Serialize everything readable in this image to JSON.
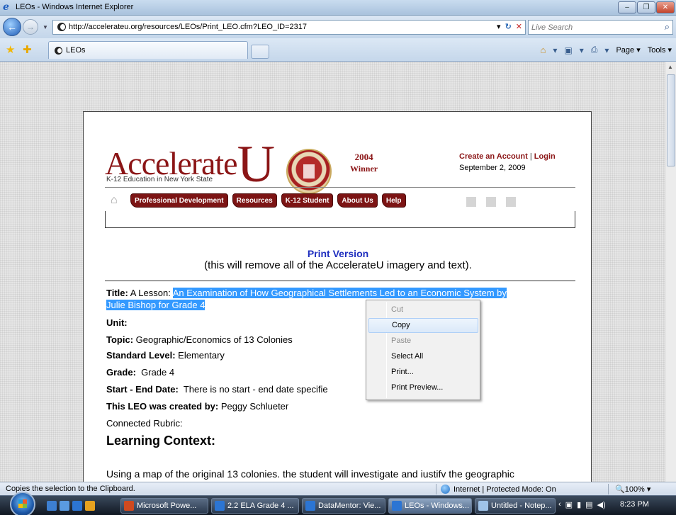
{
  "window": {
    "title": "LEOs - Windows Internet Explorer",
    "buttons": {
      "minimize": "–",
      "maximize": "❐",
      "close": "✕"
    }
  },
  "addressbar": {
    "url": "http://accelerateu.org/resources/LEOs/Print_LEO.cfm?LEO_ID=2317",
    "search_placeholder": "Live Search"
  },
  "tabbar": {
    "tab_label": "LEOs",
    "commands": {
      "page": "Page ▾",
      "tools": "Tools ▾"
    }
  },
  "site": {
    "brand": "Accelerate",
    "brand_u": "U",
    "tagline": "K-12 Education in New York State",
    "award_year": "2004",
    "award_text": "Winner",
    "create_account": "Create an Account",
    "separator": "|",
    "login": "Login",
    "date": "September 2, 2009",
    "nav": [
      "Professional Development",
      "Resources",
      "K-12 Student",
      "About Us",
      "Help"
    ]
  },
  "print": {
    "heading": "Print Version",
    "subheading": "(this will remove all of the AccelerateU imagery and text)."
  },
  "leo": {
    "title_label": "Title:",
    "title_prefix": "A Lesson:",
    "title_selected_1": "An Examination of How Geographical Settlements Led to an Economic System by",
    "title_selected_2": "Julie Bishop for Grade 4",
    "unit_label": "Unit:",
    "topic_label": "Topic:",
    "topic_value": "Geographic/Economics of 13 Colonies",
    "standard_label": "Standard Level:",
    "standard_value": "Elementary",
    "grade_label": "Grade:",
    "grade_value": "Grade 4",
    "dates_label": "Start - End Date:",
    "dates_value": "There is no start - end date specifie",
    "created_label": "This LEO was created by:",
    "created_value": "Peggy Schlueter",
    "rubric_label": "Connected Rubric:",
    "context_heading": "Learning Context:",
    "context_text": "Using a map of the original 13 colonies. the student will investigate and iustifv the geographic"
  },
  "context_menu": {
    "items": [
      "Cut",
      "Copy",
      "Paste",
      "Select All",
      "Print...",
      "Print Preview..."
    ]
  },
  "statusbar": {
    "message": "Copies the selection to the Clipboard.",
    "zone": "Internet | Protected Mode: On",
    "zoom": "100%"
  },
  "taskbar": {
    "items": [
      "Microsoft Powe...",
      "2.2 ELA Grade 4 ...",
      "DataMentor: Vie...",
      "LEOs - Windows...",
      "Untitled - Notep..."
    ],
    "clock": "8:23 PM"
  },
  "colors": {
    "brand": "#8b1516",
    "selection": "#3399ff",
    "print_heading": "#1f2fbf"
  }
}
